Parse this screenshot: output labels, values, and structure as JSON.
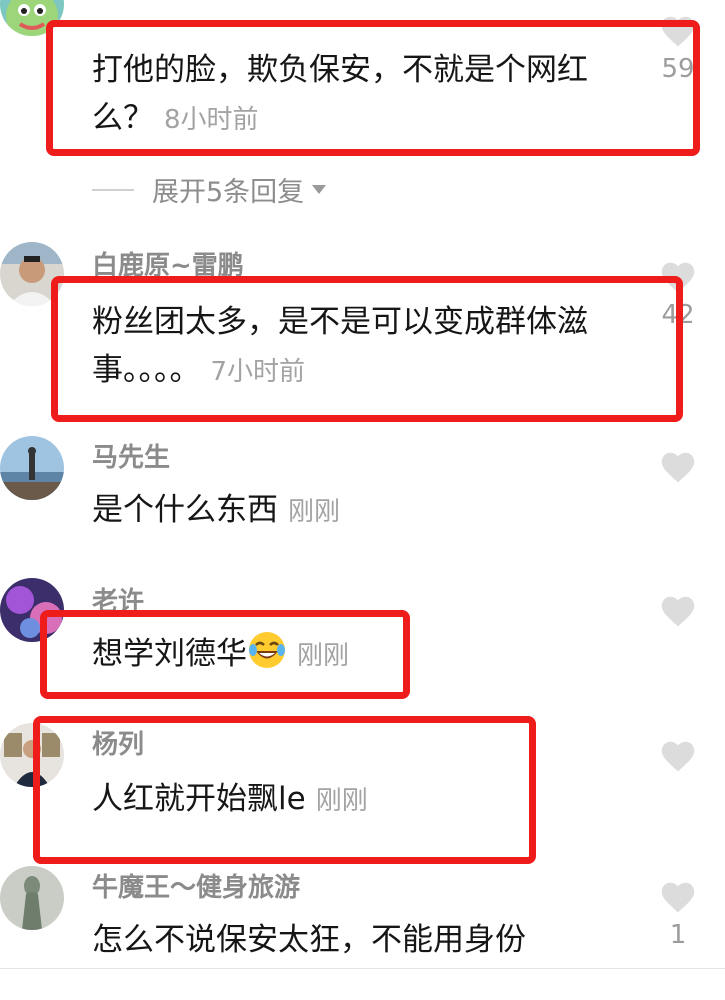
{
  "comments": [
    {
      "username": "",
      "text": "打他的脸，欺负保安，不就是个网红么？",
      "time": "8小时前",
      "likes": "59",
      "expand_label": "展开5条回复"
    },
    {
      "username": "白鹿原~雷鹏",
      "text": "粉丝团太多，是不是可以变成群体滋事。。。。",
      "time": "7小时前",
      "likes": "42"
    },
    {
      "username": "马先生",
      "text": "是个什么东西",
      "time": "刚刚",
      "likes": ""
    },
    {
      "username": "老许",
      "text": "想学刘德华",
      "time": "刚刚",
      "likes": "",
      "emoji": "rolling-laughing-emoji"
    },
    {
      "username": "杨列",
      "text": "人红就开始飘le",
      "time": "刚刚",
      "likes": ""
    },
    {
      "username": "牛魔王～健身旅游",
      "text": "怎么不说保安太狂，不能用身份",
      "time": "",
      "likes": "1"
    }
  ],
  "colors": {
    "highlight_border": "#ef1c1c",
    "username": "#8b8b8b",
    "timestamp": "#a3a3a3",
    "like_icon": "#dcdcdc"
  },
  "icons": [
    "heart-icon",
    "caret-down-icon"
  ]
}
